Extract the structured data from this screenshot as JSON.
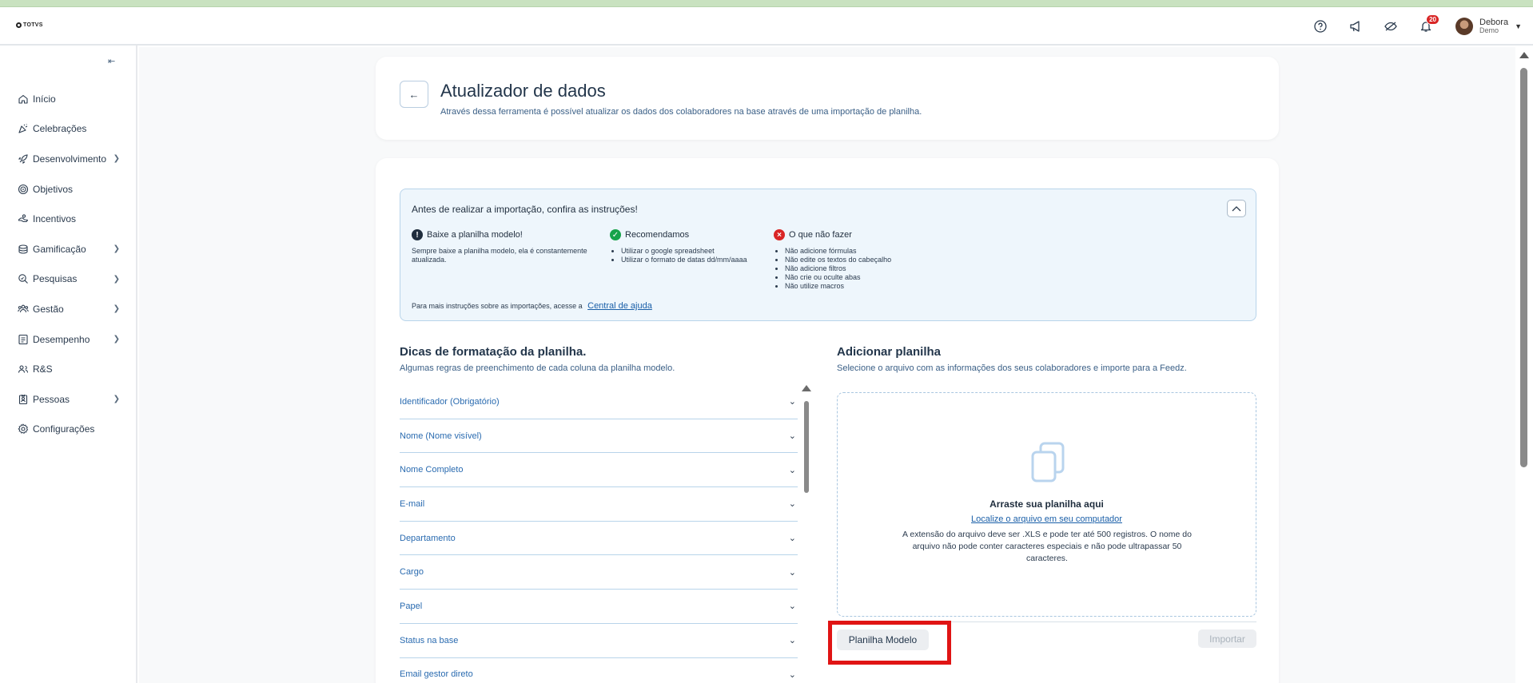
{
  "header": {
    "logo_text": "TOTVS",
    "notif_count": "20",
    "user_name": "Debora",
    "user_sub": "Demo"
  },
  "sidebar": {
    "items": [
      {
        "label": "Início",
        "chevron": false
      },
      {
        "label": "Celebrações",
        "chevron": false
      },
      {
        "label": "Desenvolvimento",
        "chevron": true
      },
      {
        "label": "Objetivos",
        "chevron": false
      },
      {
        "label": "Incentivos",
        "chevron": false
      },
      {
        "label": "Gamificação",
        "chevron": true
      },
      {
        "label": "Pesquisas",
        "chevron": true
      },
      {
        "label": "Gestão",
        "chevron": true
      },
      {
        "label": "Desempenho",
        "chevron": true
      },
      {
        "label": "R&S",
        "chevron": false
      },
      {
        "label": "Pessoas",
        "chevron": true
      },
      {
        "label": "Configurações",
        "chevron": false
      }
    ]
  },
  "page": {
    "title": "Atualizador de dados",
    "subtitle": "Através dessa ferramenta é possível atualizar os dados dos colaboradores na base através de uma importação de planilha."
  },
  "instructions": {
    "title": "Antes de realizar a importação, confira as instruções!",
    "col1_title": "Baixe a planilha modelo!",
    "col1_text": "Sempre baixe a planilha modelo, ela é constantemente atualizada.",
    "col2_title": "Recomendamos",
    "col2_items": [
      "Utilizar o google spreadsheet",
      "Utilizar o formato de datas dd/mm/aaaa"
    ],
    "col3_title": "O que não fazer",
    "col3_items": [
      "Não adicione fórmulas",
      "Não edite os textos do cabeçalho",
      "Não adicione filtros",
      "Não crie ou oculte abas",
      "Não utilize macros"
    ],
    "footer_text": "Para mais instruções sobre as importações, acesse a",
    "footer_link": "Central de ajuda"
  },
  "tips": {
    "title": "Dicas de formatação da planilha.",
    "subtitle": "Algumas regras de preenchimento de cada coluna da planilha modelo.",
    "items": [
      "Identificador (Obrigatório)",
      "Nome (Nome visível)",
      "Nome Completo",
      "E-mail",
      "Departamento",
      "Cargo",
      "Papel",
      "Status na base",
      "Email gestor direto"
    ]
  },
  "upload": {
    "title": "Adicionar planilha",
    "subtitle": "Selecione o arquivo com as informações dos seus colaboradores e importe para a Feedz.",
    "drop_title": "Arraste sua planilha aqui",
    "drop_link": "Localize o arquivo em seu computador",
    "drop_note": "A extensão do arquivo deve ser .XLS e pode ter até 500 registros. O nome do arquivo não pode conter caracteres especiais e não pode ultrapassar 50 caracteres.",
    "model_button": "Planilha Modelo",
    "import_button": "Importar"
  }
}
